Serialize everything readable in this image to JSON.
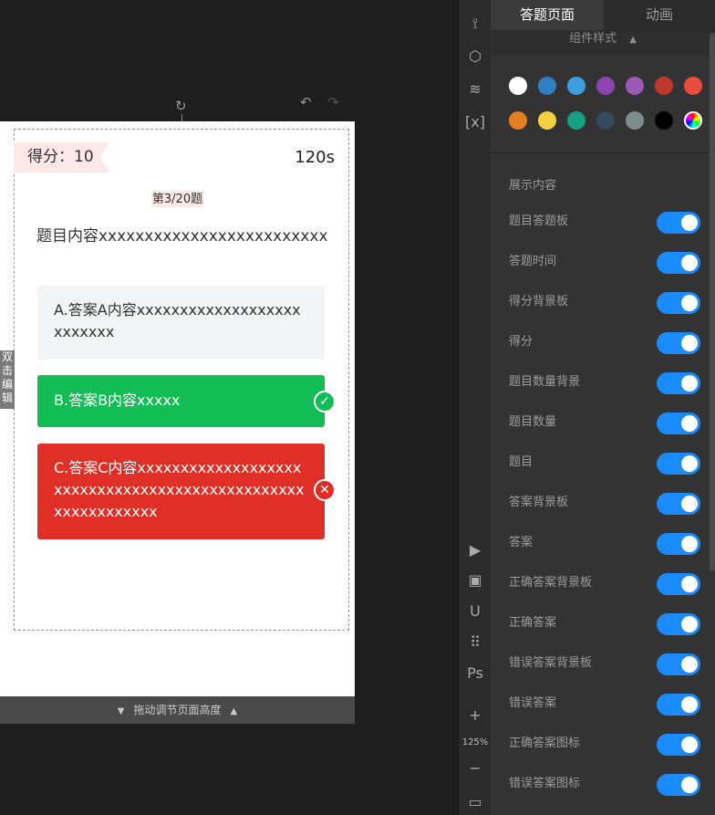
{
  "canvas": {
    "score_label": "得分：10",
    "timer": "120s",
    "question_count": "第3/20题",
    "question": "题目内容xxxxxxxxxxxxxxxxxxxxxxxxx",
    "options": [
      {
        "text": "A.答案A内容xxxxxxxxxxxxxxxxxxxxxxxxxx",
        "state": "normal"
      },
      {
        "text": "B.答案B内容xxxxx",
        "state": "correct"
      },
      {
        "text": "C.答案C内容xxxxxxxxxxxxxxxxxxxxxxxxxxxxxxxxxxxxxxxxxxxxxxxxxxxxxxxxxxxx",
        "state": "wrong"
      }
    ],
    "double_click_edit": "双击编辑",
    "resize_hint": "拖动调节页面高度"
  },
  "toolbar": {
    "zoom": "125%",
    "icons": [
      "shapes-icon",
      "cube-icon",
      "layers-icon",
      "variable-icon",
      "play-icon",
      "frame-icon",
      "magnet-icon",
      "grid-icon",
      "ps-icon",
      "zoom-in-icon",
      "zoom-out-icon",
      "comment-icon"
    ]
  },
  "panel": {
    "tabs": [
      "答题页面",
      "动画"
    ],
    "section_title": "组件样式",
    "colors": [
      "#ffffff",
      "#2e7fc4",
      "#3d9be0",
      "#8e44ad",
      "#9b59b6",
      "#c0392b",
      "#e74c3c",
      "#e67e22",
      "#f5d142",
      "#16a085",
      "#34495e",
      "#7f8c8d",
      "#000000"
    ],
    "content_title": "展示内容",
    "toggles": [
      {
        "label": "题目答题板",
        "on": true
      },
      {
        "label": "答题时间",
        "on": true
      },
      {
        "label": "得分背景板",
        "on": true
      },
      {
        "label": "得分",
        "on": true
      },
      {
        "label": "题目数量背景",
        "on": true
      },
      {
        "label": "题目数量",
        "on": true
      },
      {
        "label": "题目",
        "on": true
      },
      {
        "label": "答案背景板",
        "on": true
      },
      {
        "label": "答案",
        "on": true
      },
      {
        "label": "正确答案背景板",
        "on": true
      },
      {
        "label": "正确答案",
        "on": true
      },
      {
        "label": "错误答案背景板",
        "on": true
      },
      {
        "label": "错误答案",
        "on": true
      },
      {
        "label": "正确答案图标",
        "on": true
      },
      {
        "label": "错误答案图标",
        "on": true
      }
    ]
  }
}
